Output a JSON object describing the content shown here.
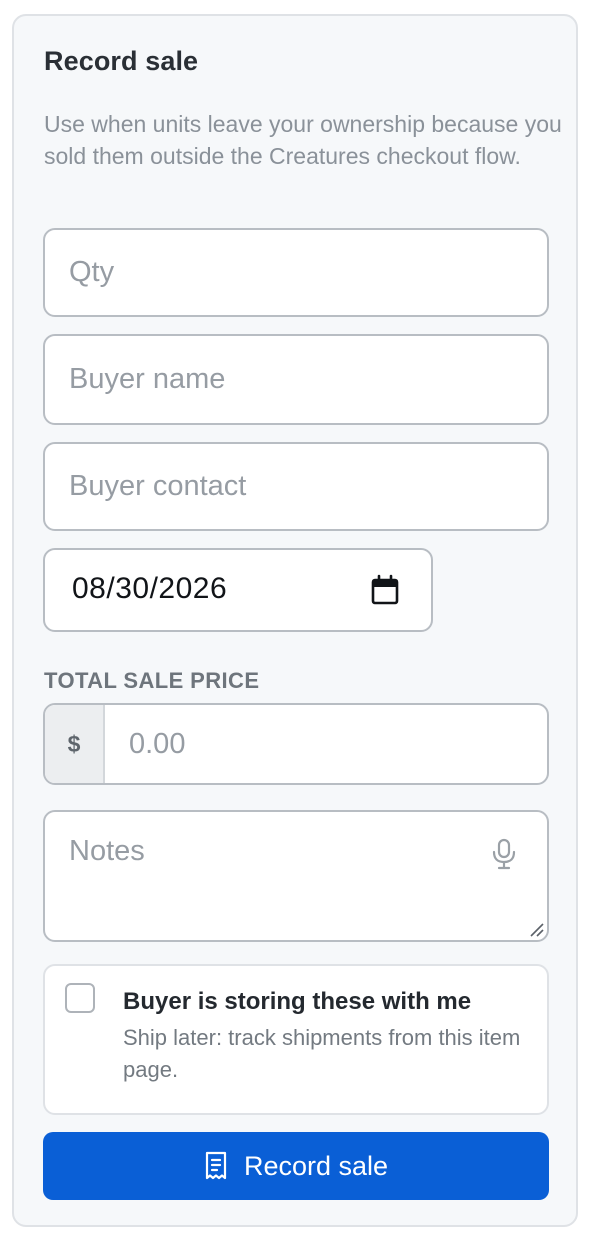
{
  "form": {
    "title": "Record sale",
    "description": "Use when units leave your ownership because you sold them outside the Creatures checkout flow.",
    "qty_placeholder": "Qty",
    "buyer_name_placeholder": "Buyer name",
    "buyer_contact_placeholder": "Buyer contact",
    "date_value": "08/30/2026",
    "price_section_label": "TOTAL SALE PRICE",
    "currency_symbol": "$",
    "price_placeholder": "0.00",
    "notes_placeholder": "Notes",
    "storage_option": {
      "title": "Buyer is storing these with me",
      "subtitle": "Ship later: track shipments from this item page.",
      "checked": false
    },
    "submit_label": "Record sale"
  },
  "icons": {
    "date": "calendar-icon",
    "notes": "microphone-icon",
    "submit": "receipt-icon"
  },
  "colors": {
    "accent": "#0a5fd6",
    "card_background": "#f6f8fa",
    "border": "#b8bdc3"
  }
}
